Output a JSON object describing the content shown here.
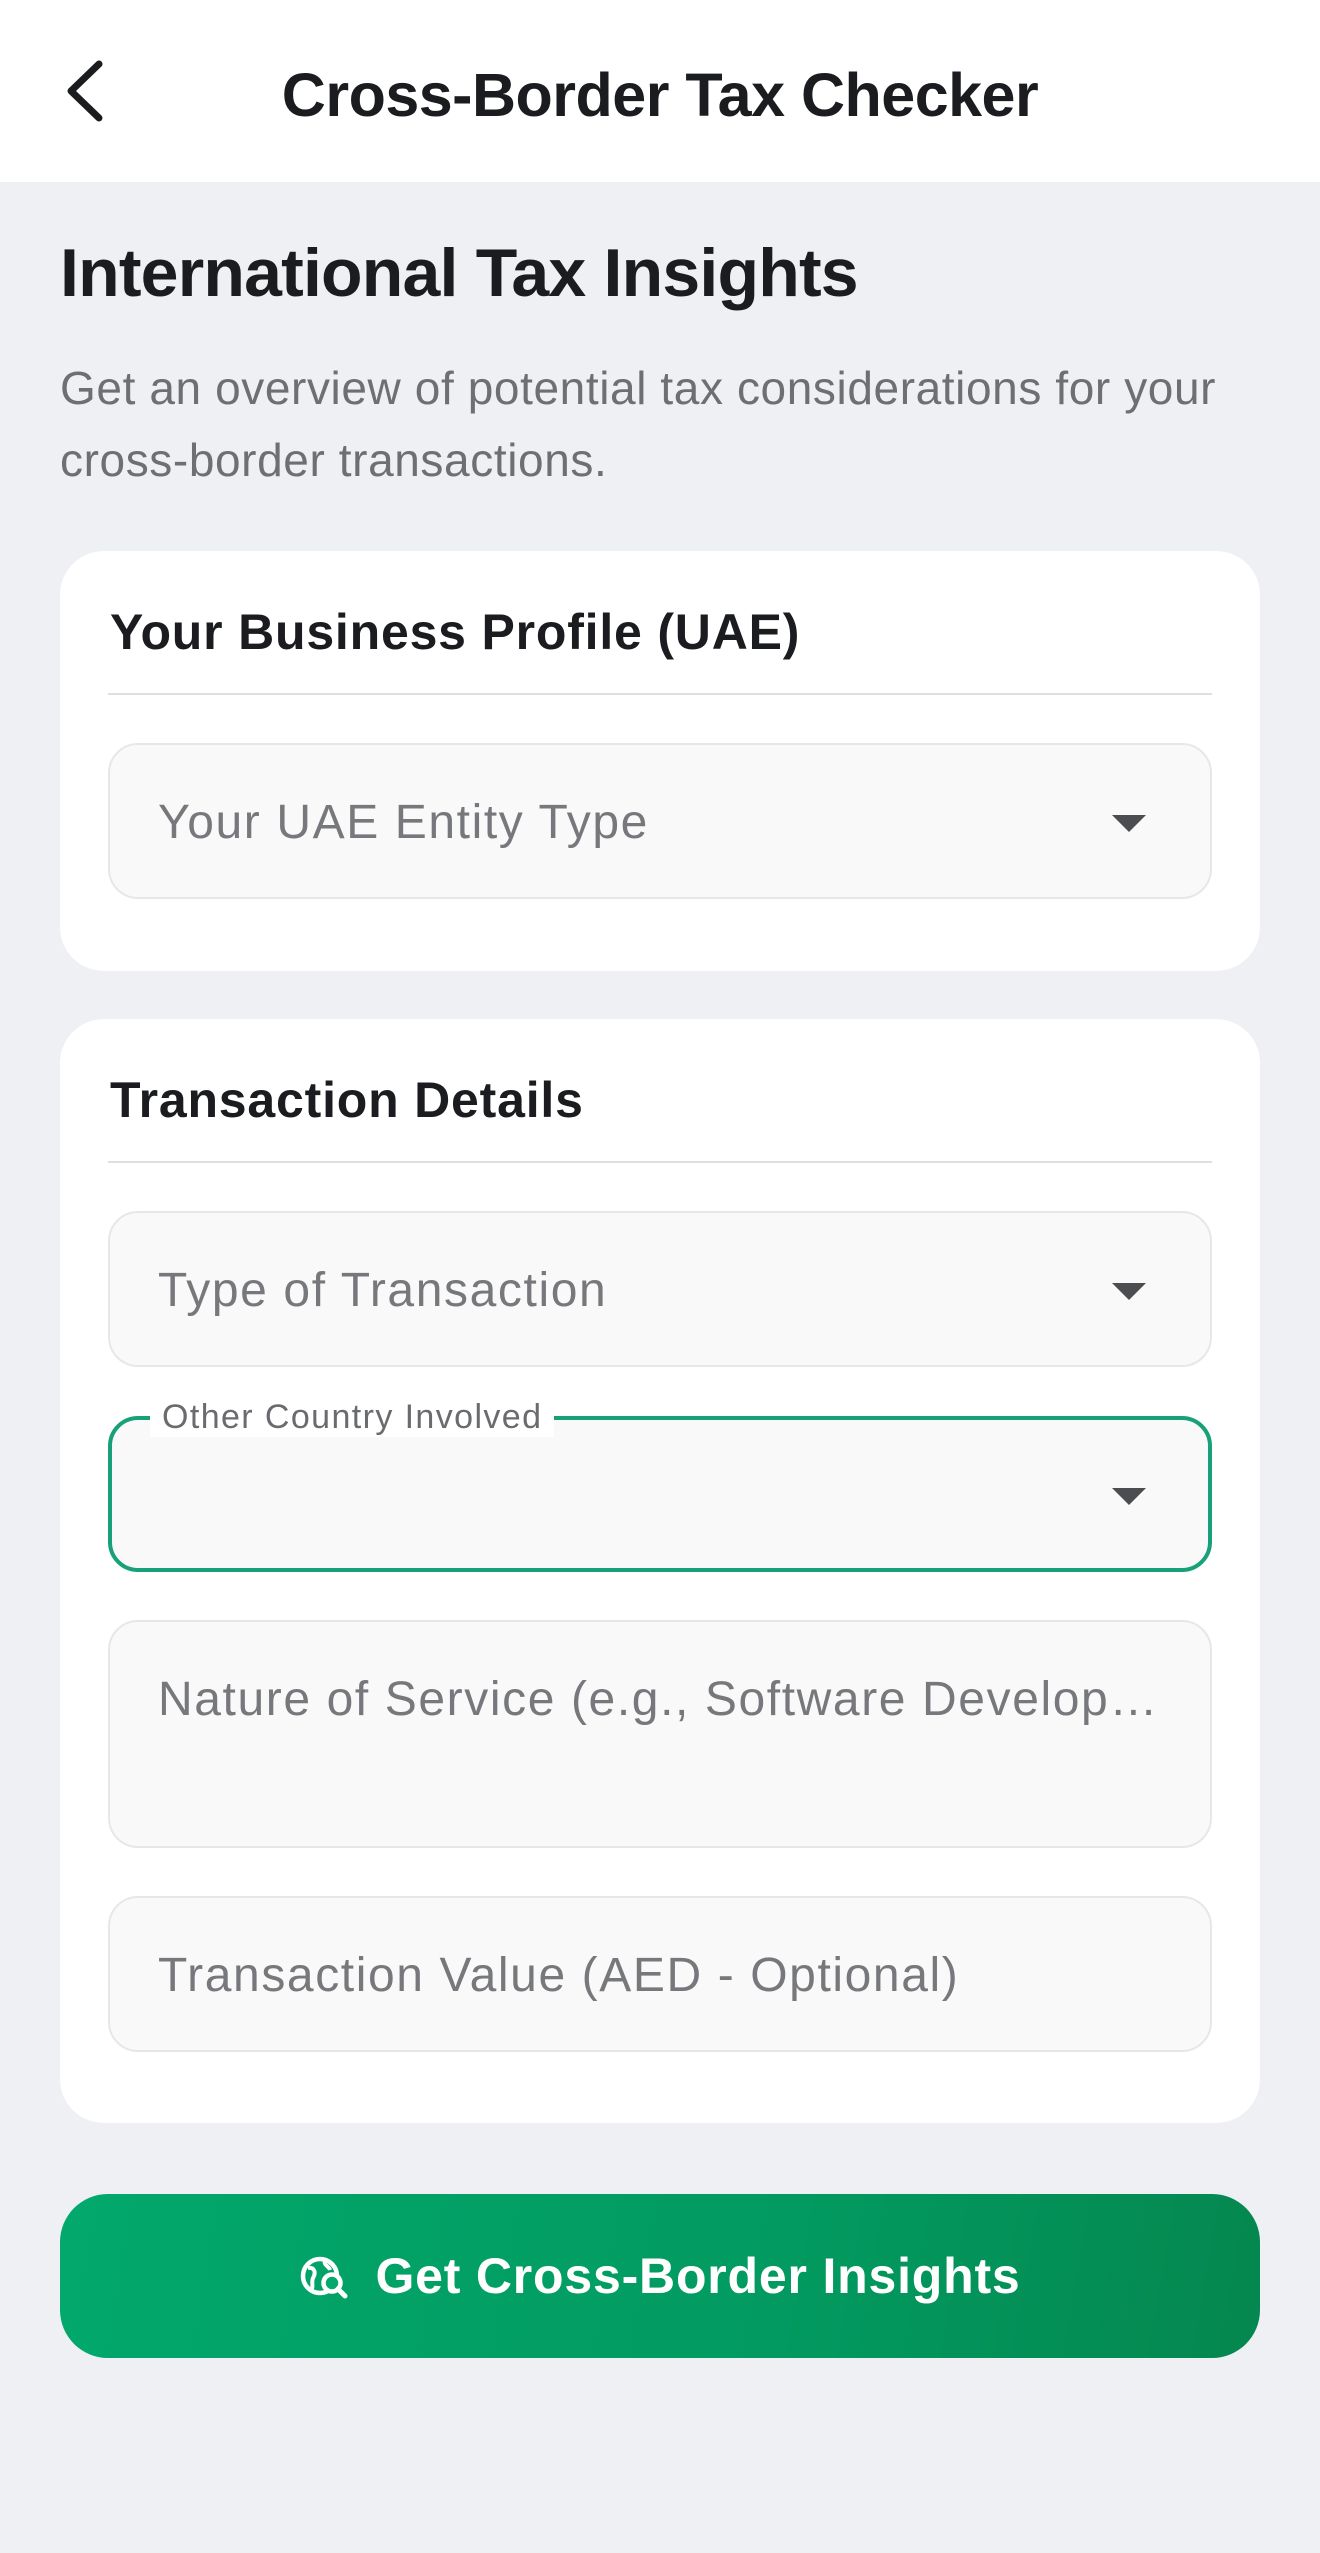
{
  "app_bar": {
    "title": "Cross-Border Tax Checker",
    "back_icon": "chevron-left-icon"
  },
  "page": {
    "heading": "International Tax Insights",
    "subtitle": "Get an overview of potential tax considerations for your cross-border transactions."
  },
  "business_profile": {
    "title": "Your Business Profile (UAE)",
    "entity_type": {
      "placeholder": "Your UAE Entity Type",
      "value": ""
    }
  },
  "transaction_details": {
    "title": "Transaction Details",
    "transaction_type": {
      "placeholder": "Type of Transaction",
      "value": ""
    },
    "country": {
      "label": "Other Country Involved",
      "value": ""
    },
    "nature_of_service": {
      "placeholder": "Nature of Service (e.g., Software Development)",
      "value": ""
    },
    "transaction_value": {
      "placeholder": "Transaction Value (AED - Optional)",
      "value": ""
    }
  },
  "cta": {
    "label": "Get Cross-Border Insights",
    "icon": "globe-search-icon"
  },
  "colors": {
    "accent": "#18a078",
    "button_start": "#02a86c",
    "button_end": "#04874f",
    "background": "#eff0f4"
  }
}
